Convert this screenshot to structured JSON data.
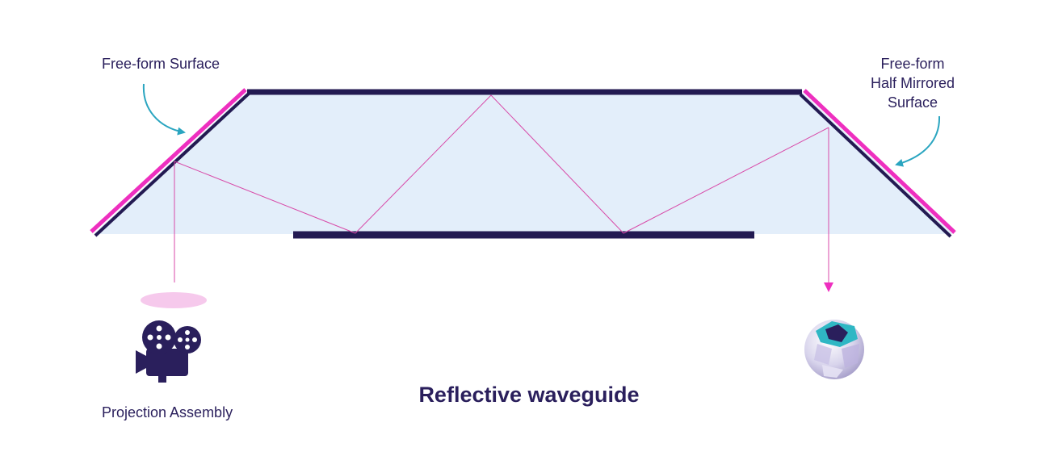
{
  "labels": {
    "freeform_surface": "Free-form Surface",
    "half_mirrored_line1": "Free-form",
    "half_mirrored_line2": "Half Mirrored",
    "half_mirrored_line3": "Surface",
    "projection_assembly": "Projection Assembly"
  },
  "title": "Reflective waveguide",
  "colors": {
    "waveguide_fill": "#e3eefa",
    "edge": "#231a52",
    "mirror": "#ee2fbf",
    "ray": "#d84aa8",
    "annotation_arrow": "#2aa5c0",
    "text": "#2a1f5c",
    "lens_ellipse": "#f6c9ec"
  },
  "icons": {
    "projector": "film-camera-icon",
    "eye": "eyeball-icon"
  }
}
